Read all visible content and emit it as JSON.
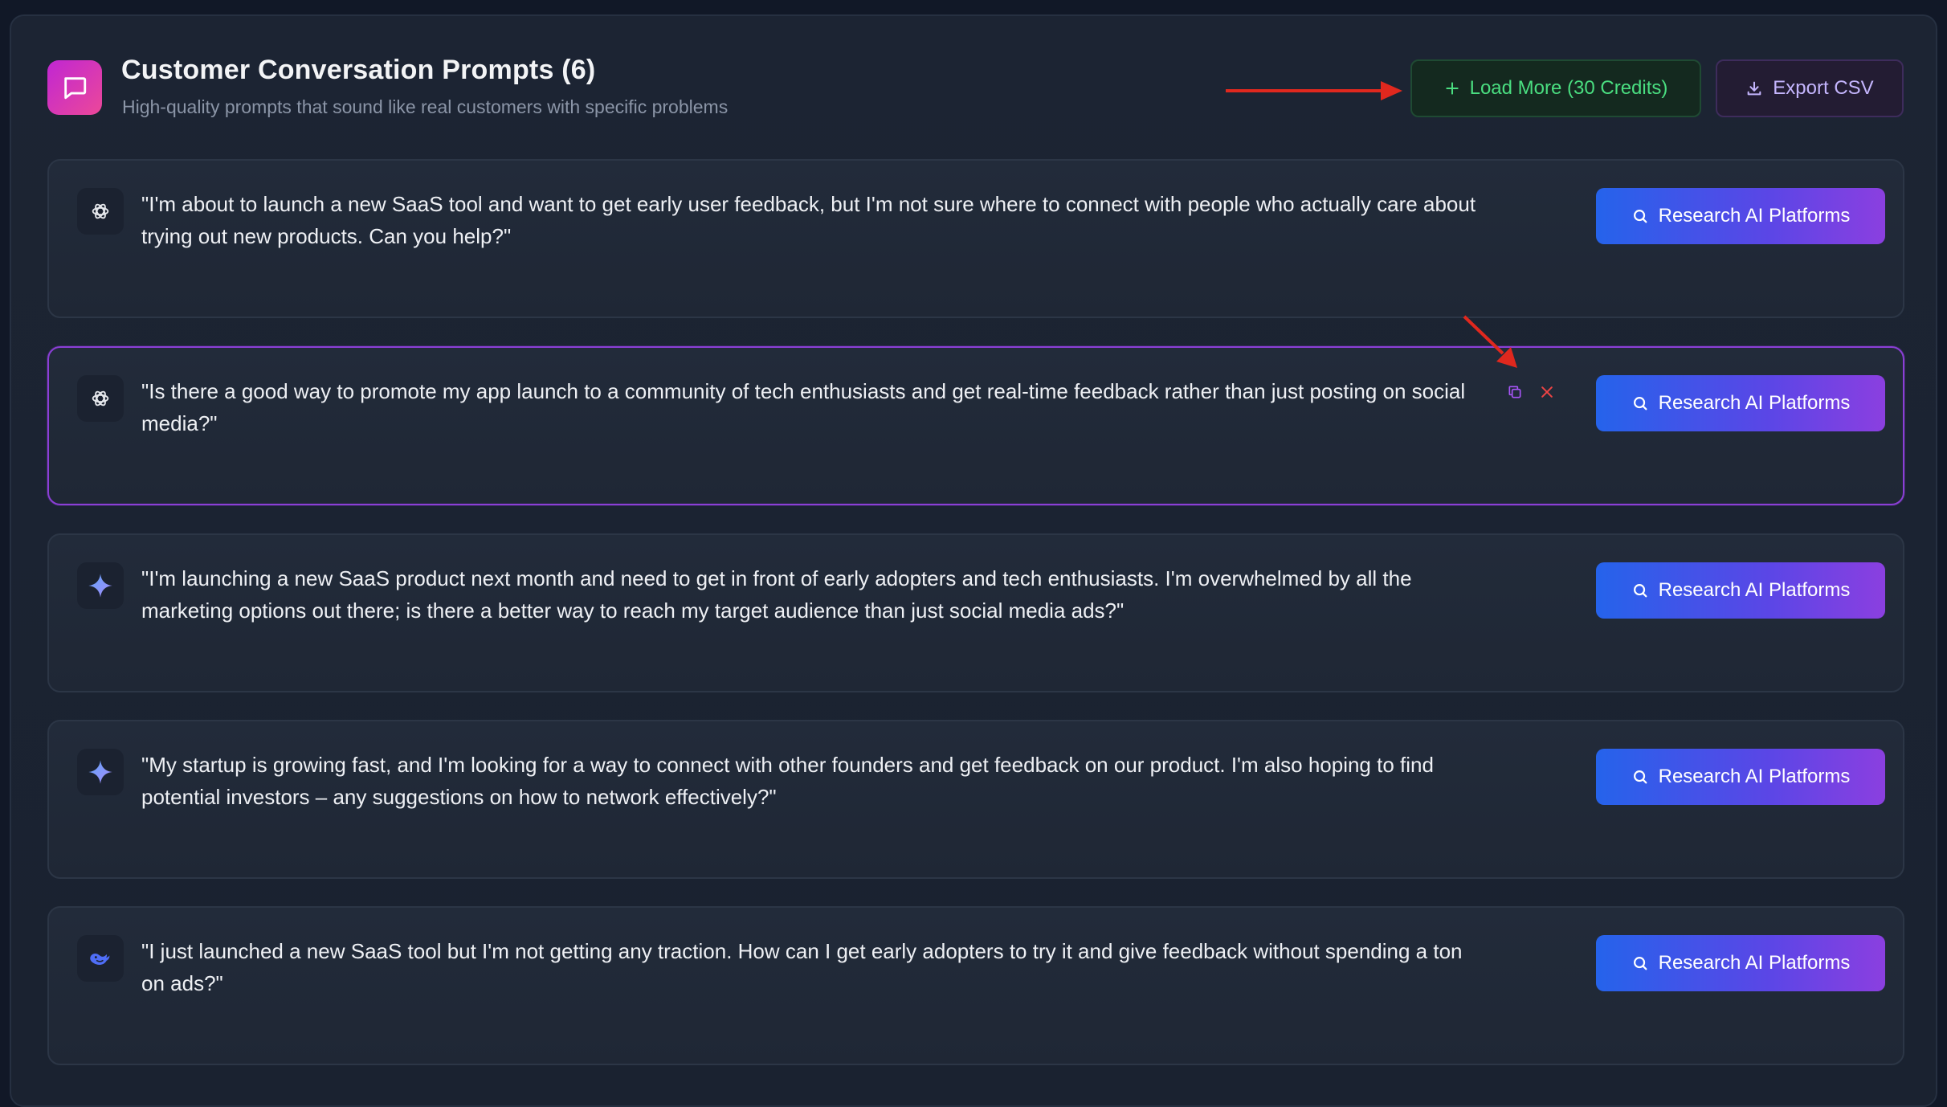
{
  "header": {
    "icon": "chat-bubble-icon",
    "title": "Customer Conversation Prompts (6)",
    "subtitle": "High-quality prompts that sound like real customers with specific problems",
    "load_more_label": "Load More (30 Credits)",
    "export_label": "Export CSV"
  },
  "colors": {
    "accent_green": "#4ade80",
    "accent_purple": "#8b3fd6",
    "button_gradient_start": "#2563eb",
    "button_gradient_end": "#8b3fe0",
    "annotation_arrow": "#e0281e"
  },
  "research_label": "Research AI Platforms",
  "prompts": [
    {
      "model_icon": "openai-icon",
      "text": "\"I'm about to launch a new SaaS tool and want to get early user feedback, but I'm not sure where to connect with people who actually care about trying out new products. Can you help?\"",
      "active": false
    },
    {
      "model_icon": "openai-icon",
      "text": "\"Is there a good way to promote my app launch to a community of tech enthusiasts and get real-time feedback rather than just posting on social media?\"",
      "active": true
    },
    {
      "model_icon": "gemini-icon",
      "text": "\"I'm launching a new SaaS product next month and need to get in front of early adopters and tech enthusiasts. I'm overwhelmed by all the marketing options out there; is there a better way to reach my target audience than just social media ads?\"",
      "active": false
    },
    {
      "model_icon": "gemini-icon",
      "text": "\"My startup is growing fast, and I'm looking for a way to connect with other founders and get feedback on our product. I'm also hoping to find potential investors – any suggestions on how to network effectively?\"",
      "active": false
    },
    {
      "model_icon": "deepseek-icon",
      "text": "\"I just launched a new SaaS tool but I'm not getting any traction. How can I get early adopters to try it and give feedback without spending a ton on ads?\"",
      "active": false
    }
  ]
}
